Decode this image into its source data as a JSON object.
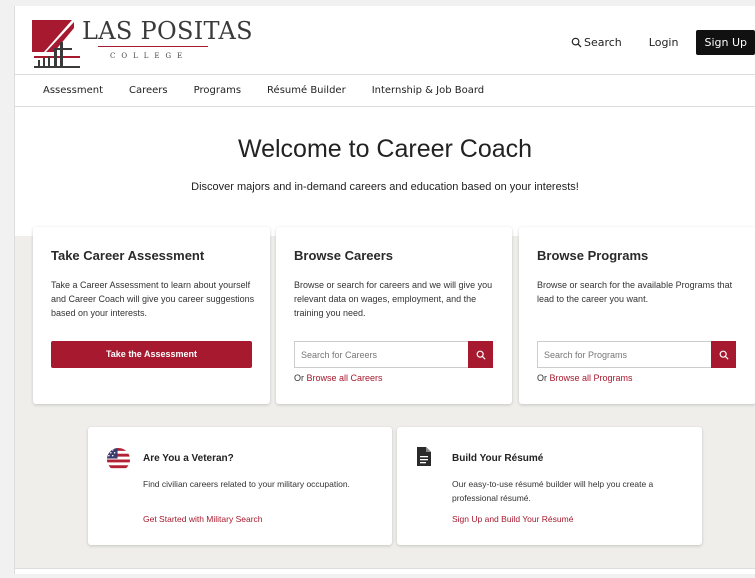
{
  "brand": {
    "name": "LAS POSITAS",
    "sub": "COLLEGE",
    "accent_color": "#a6192e"
  },
  "header": {
    "search_label": "Search",
    "login_label": "Login",
    "signup_label": "Sign Up"
  },
  "nav": {
    "items": [
      {
        "label": "Assessment"
      },
      {
        "label": "Careers"
      },
      {
        "label": "Programs"
      },
      {
        "label": "Résumé Builder"
      },
      {
        "label": "Internship & Job Board"
      }
    ]
  },
  "hero": {
    "title": "Welcome to Career Coach",
    "subtitle": "Discover majors and in-demand careers and education based on your interests!"
  },
  "cards": {
    "assessment": {
      "title": "Take Career Assessment",
      "text": "Take a Career Assessment to learn about yourself and Career Coach will give you career suggestions based on your interests.",
      "button": "Take the Assessment"
    },
    "careers": {
      "title": "Browse Careers",
      "text": "Browse or search for careers and we will give you relevant data on wages, employment, and the training you need.",
      "placeholder": "Search for Careers",
      "or": "Or",
      "link": "Browse all Careers",
      "icon": "search-icon"
    },
    "programs": {
      "title": "Browse Programs",
      "text": "Browse or search for the available Programs that lead to the career you want.",
      "placeholder": "Search for Programs",
      "or": "Or",
      "link": "Browse all Programs",
      "icon": "search-icon"
    }
  },
  "lower": {
    "veteran": {
      "title": "Are You a Veteran?",
      "text": "Find civilian careers related to your military occupation.",
      "link": "Get Started with Military Search",
      "icon": "us-flag-icon"
    },
    "resume": {
      "title": "Build Your Résumé",
      "text": "Our easy-to-use résumé builder will help you create a professional résumé.",
      "link": "Sign Up and Build Your Résumé",
      "icon": "document-icon"
    }
  }
}
